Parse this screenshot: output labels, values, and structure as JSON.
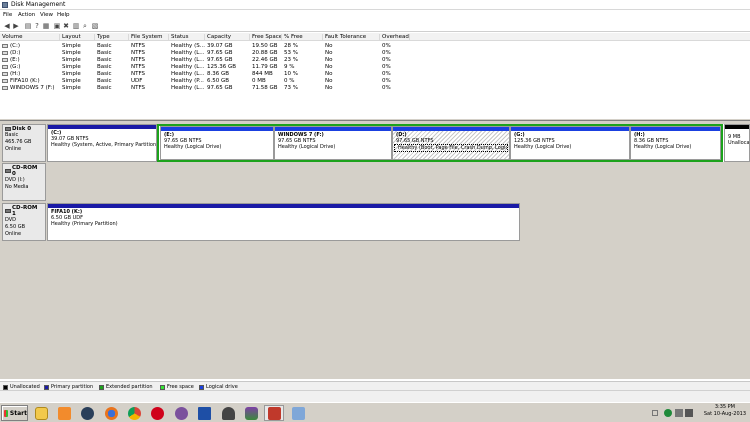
{
  "window": {
    "title": "Disk Management"
  },
  "menu": [
    "File",
    "Action",
    "View",
    "Help"
  ],
  "toolbar": [
    "back-icon",
    "forward-icon",
    "properties-icon",
    "help-icon",
    "refresh-icon",
    "connect-icon",
    "delete-icon",
    "format-icon",
    "search-icon",
    "zoom-icon"
  ],
  "volume_table": {
    "headers": [
      "Volume",
      "Layout",
      "Type",
      "File System",
      "Status",
      "Capacity",
      "Free Space",
      "% Free",
      "Fault Tolerance",
      "Overhead"
    ],
    "rows": [
      [
        "(C:)",
        "Simple",
        "Basic",
        "NTFS",
        "Healthy (S...",
        "39.07 GB",
        "19.50 GB",
        "28 %",
        "No",
        "0%"
      ],
      [
        "(D:)",
        "Simple",
        "Basic",
        "NTFS",
        "Healthy (L...",
        "97.65 GB",
        "20.88 GB",
        "53 %",
        "No",
        "0%"
      ],
      [
        "(E:)",
        "Simple",
        "Basic",
        "NTFS",
        "Healthy (L...",
        "97.65 GB",
        "22.46 GB",
        "23 %",
        "No",
        "0%"
      ],
      [
        "(G:)",
        "Simple",
        "Basic",
        "NTFS",
        "Healthy (L...",
        "125.36 GB",
        "11.79 GB",
        "9 %",
        "No",
        "0%"
      ],
      [
        "(H:)",
        "Simple",
        "Basic",
        "NTFS",
        "Healthy (L...",
        "8.36 GB",
        "844 MB",
        "10 %",
        "No",
        "0%"
      ],
      [
        "FIFA10 (K:)",
        "Simple",
        "Basic",
        "UDF",
        "Healthy (P...",
        "6.50 GB",
        "0 MB",
        "0 %",
        "No",
        "0%"
      ],
      [
        "WINDOWS 7 (F:)",
        "Simple",
        "Basic",
        "NTFS",
        "Healthy (L...",
        "97.65 GB",
        "71.58 GB",
        "73 %",
        "No",
        "0%"
      ]
    ]
  },
  "disks": [
    {
      "name": "Disk 0",
      "lines": [
        "Basic",
        "465.76 GB",
        "Online"
      ],
      "partitions": [
        {
          "name": "(C:)",
          "size": "39.07 GB NTFS",
          "status": "Healthy (System, Active, Primary Partition)"
        },
        {
          "name": "(E:)",
          "size": "97.65 GB NTFS",
          "status": "Healthy (Logical Drive)"
        },
        {
          "name": "WINDOWS 7  (F:)",
          "size": "97.65 GB NTFS",
          "status": "Healthy (Logical Drive)"
        },
        {
          "name": "(D:)",
          "size": "97.65 GB NTFS",
          "status": "Healthy (Boot, Page File, Crash Dump, Logical Drive)"
        },
        {
          "name": "(G:)",
          "size": "125.36 GB NTFS",
          "status": "Healthy (Logical Drive)"
        },
        {
          "name": "(H:)",
          "size": "8.36 GB NTFS",
          "status": "Healthy (Logical Drive)"
        },
        {
          "name": "",
          "size": "9 MB",
          "status": "Unallocat"
        }
      ]
    },
    {
      "name": "CD-ROM 0",
      "lines": [
        "DVD (I:)",
        "",
        "No Media"
      ]
    },
    {
      "name": "CD-ROM 1",
      "lines": [
        "DVD",
        "6.50 GB",
        "Online"
      ],
      "partitions": [
        {
          "name": "FIFA10  (K:)",
          "size": "6.50 GB UDF",
          "status": "Healthy (Primary Partition)"
        }
      ]
    }
  ],
  "legend": [
    {
      "label": "Unallocated",
      "color": "#000000"
    },
    {
      "label": "Primary partition",
      "color": "#1a1aa6"
    },
    {
      "label": "Extended partition",
      "color": "#1ca21c"
    },
    {
      "label": "Free space",
      "color": "#33e633"
    },
    {
      "label": "Logical drive",
      "color": "#1a40e0"
    }
  ],
  "taskbar": {
    "start_label": "Start",
    "apps": [
      "folder-icon",
      "media-player-icon",
      "steam-icon",
      "firefox-icon",
      "chrome-icon",
      "opera-icon",
      "viber-icon",
      "fifa10-icon",
      "inkscape-icon",
      "winrar-icon",
      "disk-management-icon",
      "paint-icon"
    ],
    "clock_time": "3:35 PM",
    "clock_date": "Sat 10-Aug-2013"
  }
}
